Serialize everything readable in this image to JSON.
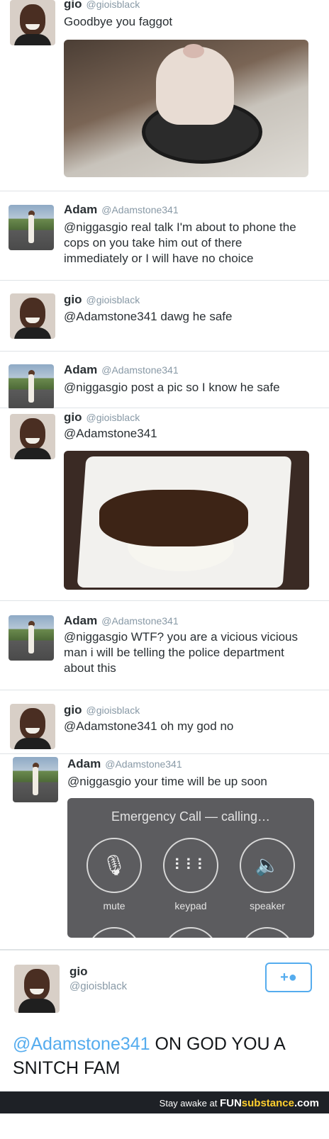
{
  "tweets": [
    {
      "name": "gio",
      "handle": "@gioisblack",
      "text": "Goodbye you faggot"
    },
    {
      "name": "Adam",
      "handle": "@Adamstone341",
      "text": "@niggasgio real talk I'm about to phone the cops on you take him out of there immediately or I will have no choice"
    },
    {
      "name": "gio",
      "handle": "@gioisblack",
      "text": "@Adamstone341 dawg he safe"
    },
    {
      "name": "Adam",
      "handle": "@Adamstone341",
      "text": "@niggasgio post a pic so I know he safe"
    },
    {
      "name": "gio",
      "handle": "@gioisblack",
      "text": "@Adamstone341"
    },
    {
      "name": "Adam",
      "handle": "@Adamstone341",
      "text": "@niggasgio WTF? you are a vicious vicious man i will be telling the police department about this"
    },
    {
      "name": "gio",
      "handle": "@gioisblack",
      "text": "@Adamstone341 oh my god no"
    },
    {
      "name": "Adam",
      "handle": "@Adamstone341",
      "text": "@niggasgio your time will be up soon"
    }
  ],
  "call": {
    "title": "Emergency Call — calling…",
    "buttons": [
      {
        "label": "mute",
        "icon": "mic-off-icon"
      },
      {
        "label": "keypad",
        "icon": "keypad-icon"
      },
      {
        "label": "speaker",
        "icon": "speaker-icon"
      }
    ]
  },
  "final": {
    "name": "gio",
    "handle": "@gioisblack",
    "mention": "@Adamstone341",
    "text": " ON GOD YOU A SNITCH FAM",
    "follow_icon": "add-user-icon"
  },
  "footer": {
    "text": "Stay awake at",
    "brand_a": "FUN",
    "brand_b": "substance",
    "brand_c": ".com"
  }
}
